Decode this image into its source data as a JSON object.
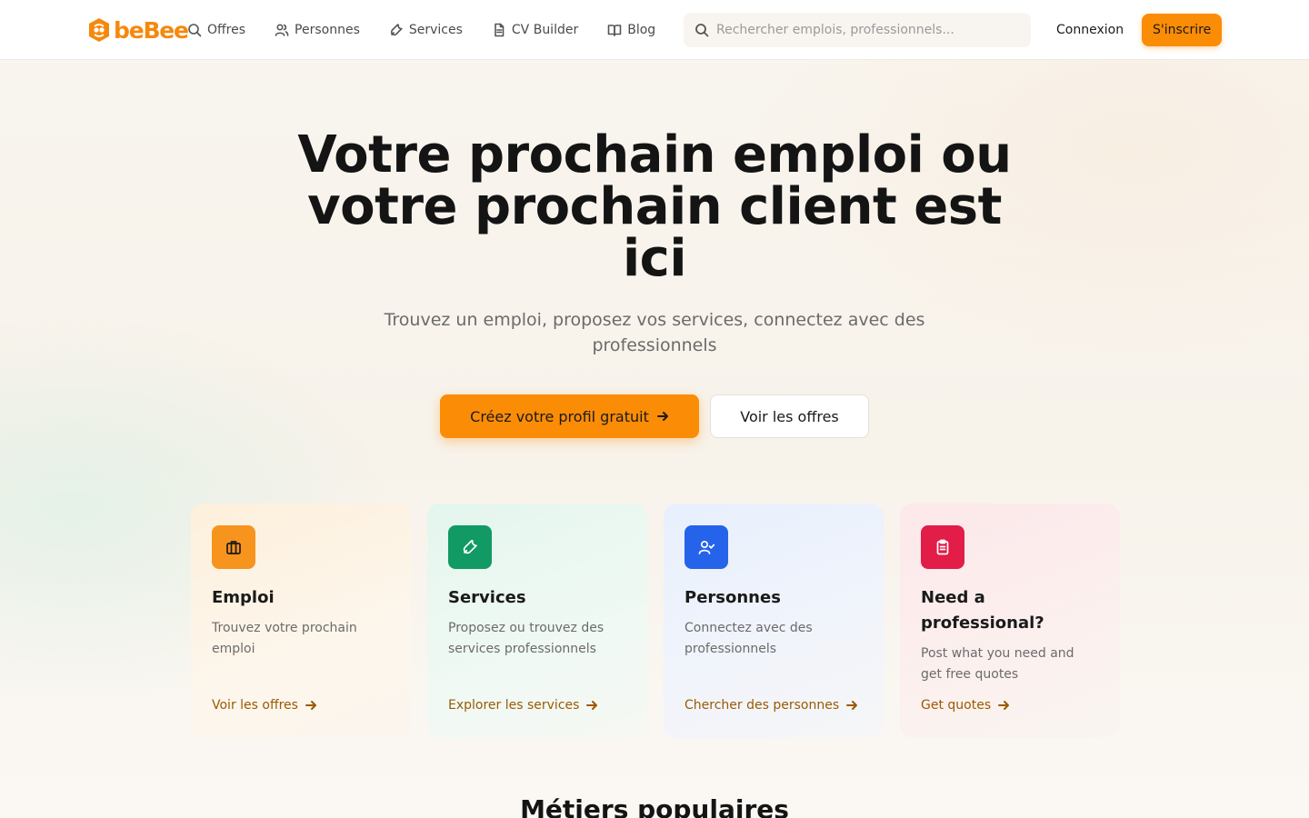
{
  "brand": {
    "name": "beBee",
    "color": "#f5890d",
    "icon": "bee-hexagon-logo"
  },
  "nav": {
    "items": [
      {
        "label": "Offres",
        "icon": "search-icon"
      },
      {
        "label": "Personnes",
        "icon": "users-icon"
      },
      {
        "label": "Services",
        "icon": "wrench-icon"
      },
      {
        "label": "CV Builder",
        "icon": "document-icon"
      },
      {
        "label": "Blog",
        "icon": "book-icon"
      }
    ]
  },
  "search": {
    "placeholder": "Rechercher emplois, professionnels...",
    "value": ""
  },
  "auth": {
    "login_label": "Connexion",
    "signup_label": "S'inscrire"
  },
  "hero": {
    "title": "Votre prochain emploi ou votre prochain client est ici",
    "subtitle": "Trouvez un emploi, proposez vos services, connectez avec des professionnels",
    "primary_cta": "Créez votre profil gratuit",
    "secondary_cta": "Voir les offres"
  },
  "cards": [
    {
      "title": "Emploi",
      "description": "Trouvez votre prochain emploi",
      "link": "Voir les offres",
      "icon": "briefcase-icon",
      "icon_color": "#f7941d"
    },
    {
      "title": "Services",
      "description": "Proposez ou trouvez des services professionnels",
      "link": "Explorer les services",
      "icon": "wrench-icon",
      "icon_color": "#119a63"
    },
    {
      "title": "Personnes",
      "description": "Connectez avec des professionnels",
      "link": "Chercher des personnes",
      "icon": "user-check-icon",
      "icon_color": "#2563eb"
    },
    {
      "title": "Need a professional?",
      "description": "Post what you need and get free quotes",
      "link": "Get quotes",
      "icon": "clipboard-icon",
      "icon_color": "#e11d48"
    }
  ],
  "sections": {
    "popular_title": "Métiers populaires"
  },
  "colors": {
    "accent": "#fb8c06",
    "link": "#9a5a00"
  }
}
